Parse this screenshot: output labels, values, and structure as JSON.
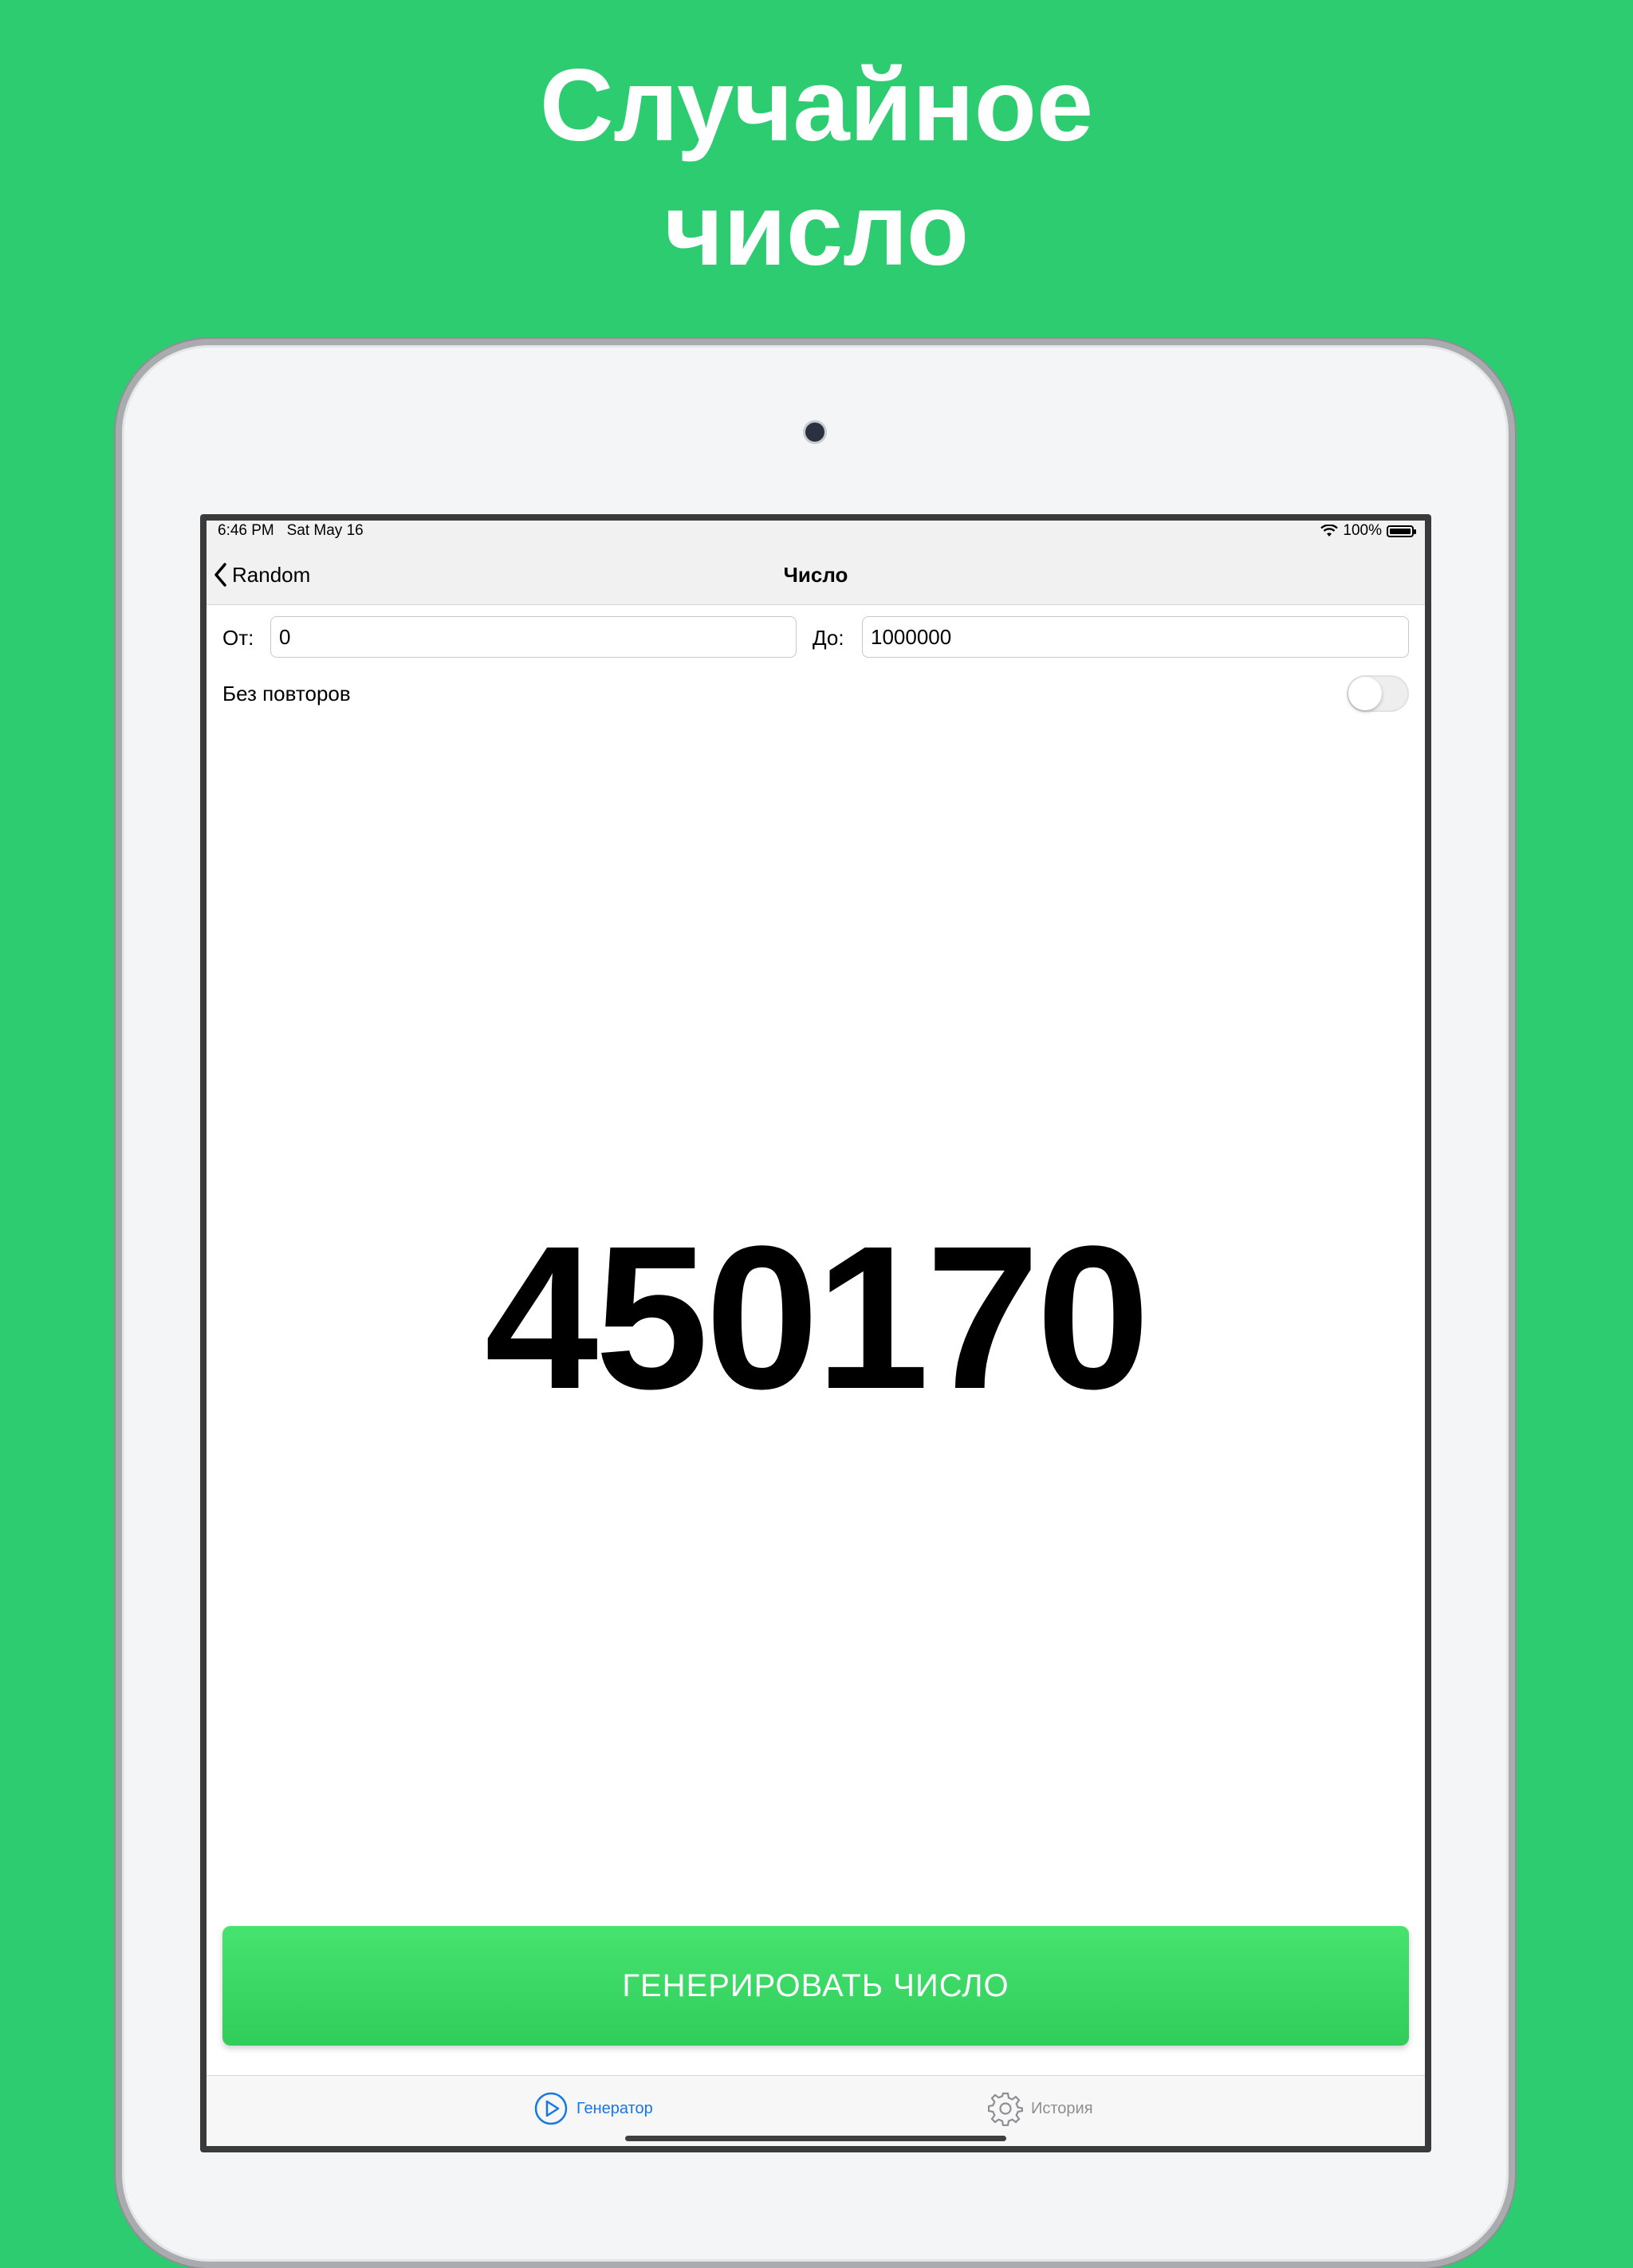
{
  "promo": {
    "headline_line1": "Случайное",
    "headline_line2": "число"
  },
  "status_bar": {
    "time": "6:46 PM",
    "date": "Sat May 16",
    "battery": "100%"
  },
  "nav": {
    "back_label": "Random",
    "title": "Число"
  },
  "range": {
    "from_label": "От:",
    "from_value": "0",
    "to_label": "До:",
    "to_value": "1000000"
  },
  "options": {
    "no_repeat_label": "Без повторов",
    "no_repeat_enabled": false
  },
  "result": {
    "value": "450170"
  },
  "actions": {
    "generate_label": "ГЕНЕРИРОВАТЬ ЧИСЛО"
  },
  "tabs": [
    {
      "label": "Генератор",
      "icon": "play-circle-icon",
      "active": true
    },
    {
      "label": "История",
      "icon": "gear-icon",
      "active": false
    }
  ],
  "colors": {
    "background": "#2ecc71",
    "button_green": "#3ad865",
    "tab_active": "#1677e6",
    "tab_inactive": "#8e8e93"
  }
}
